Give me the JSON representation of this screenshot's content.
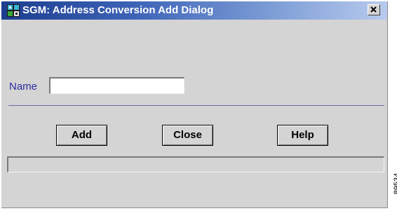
{
  "window": {
    "title": "SGM: Address Conversion Add Dialog",
    "close_icon": "close-x-icon",
    "app_icon": "sgm-network-icon"
  },
  "form": {
    "name_label": "Name",
    "name_value": ""
  },
  "buttons": {
    "add": "Add",
    "close": "Close",
    "help": "Help"
  },
  "status_bar": {
    "text": ""
  },
  "figure_id": "89534",
  "colors": {
    "titlebar_start": "#1c3d8f",
    "titlebar_end": "#b8cbee",
    "dialog_bg": "#d4d4d4",
    "label_color": "#2d2d9e"
  }
}
